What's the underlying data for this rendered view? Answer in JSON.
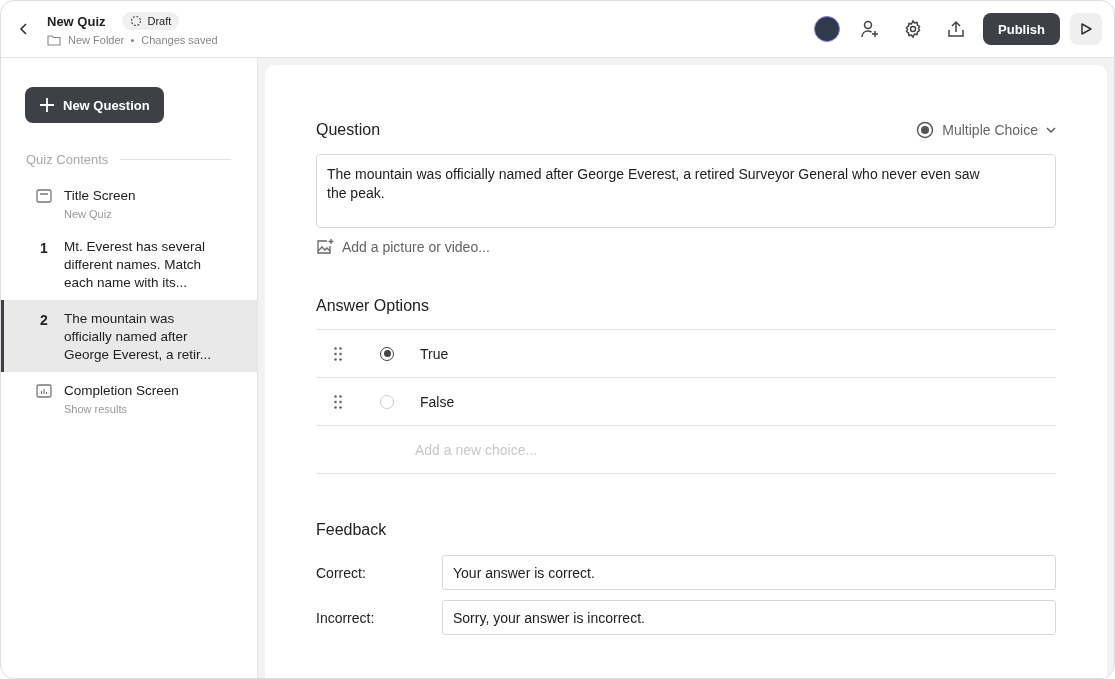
{
  "header": {
    "title": "New Quiz",
    "status": "Draft",
    "folder": "New Folder",
    "save_state": "Changes saved",
    "publish": "Publish"
  },
  "sidebar": {
    "new_button": "New Question",
    "section": "Quiz Contents",
    "items": [
      {
        "kind": "title",
        "label": "Title Screen",
        "sub": "New Quiz",
        "selected": false
      },
      {
        "kind": "question",
        "number": "1",
        "label": "Mt. Everest has several different names. Match each name with its...",
        "selected": false
      },
      {
        "kind": "question",
        "number": "2",
        "label": "The mountain was officially named after George Everest, a retir...",
        "selected": true
      },
      {
        "kind": "completion",
        "label": "Completion Screen",
        "sub": "Show results",
        "selected": false
      }
    ]
  },
  "question": {
    "heading": "Question",
    "type": "Multiple Choice",
    "text": "The mountain was officially named after George Everest, a retired Surveyor General who never even saw the peak.",
    "media": "Add a picture or video..."
  },
  "answers": {
    "heading": "Answer Options",
    "options": [
      {
        "label": "True",
        "selected": true
      },
      {
        "label": "False",
        "selected": false
      }
    ],
    "placeholder": "Add a new choice..."
  },
  "feedback": {
    "heading": "Feedback",
    "rows": [
      {
        "label": "Correct:",
        "value": "Your answer is correct."
      },
      {
        "label": "Incorrect:",
        "value": "Sorry, your answer is incorrect."
      }
    ]
  }
}
